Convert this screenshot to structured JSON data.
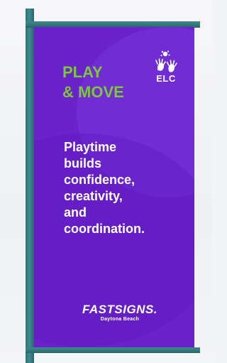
{
  "banner": {
    "headline_line1": "PLAY",
    "headline_line2": "& MOVE",
    "logo_text": "ELC",
    "body_lines": [
      "Playtime",
      "builds",
      "confidence,",
      "creativity,",
      "and",
      "coordination."
    ],
    "brand_name": "FASTSIGNS.",
    "brand_location": "Daytona Beach"
  },
  "colors": {
    "banner_purple": "#6a22c9",
    "headline_green": "#7dc63f",
    "pole_teal": "#2f6f73",
    "text_white": "#ffffff"
  }
}
